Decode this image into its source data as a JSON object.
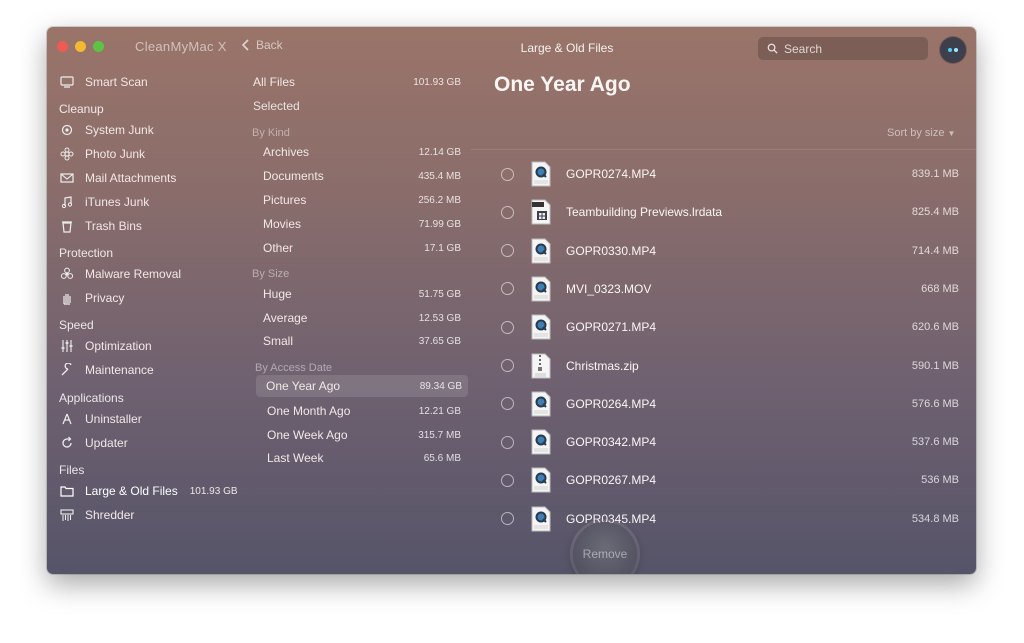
{
  "app": {
    "title": "CleanMyMac X",
    "back_label": "Back",
    "section_title": "Large & Old Files"
  },
  "search": {
    "placeholder": "Search"
  },
  "sidebar": {
    "smart_scan": "Smart Scan",
    "groups": [
      {
        "header": "Cleanup",
        "items": [
          "System Junk",
          "Photo Junk",
          "Mail Attachments",
          "iTunes Junk",
          "Trash Bins"
        ]
      },
      {
        "header": "Protection",
        "items": [
          "Malware Removal",
          "Privacy"
        ]
      },
      {
        "header": "Speed",
        "items": [
          "Optimization",
          "Maintenance"
        ]
      },
      {
        "header": "Applications",
        "items": [
          "Uninstaller",
          "Updater"
        ]
      },
      {
        "header": "Files",
        "items": [
          "Large & Old Files",
          "Shredder"
        ]
      }
    ],
    "large_files_badge": "101.93 GB"
  },
  "filters": {
    "all_files": {
      "label": "All Files",
      "size": "101.93 GB"
    },
    "selected": "Selected",
    "by_kind": {
      "header": "By Kind",
      "items": [
        {
          "label": "Archives",
          "size": "12.14 GB"
        },
        {
          "label": "Documents",
          "size": "435.4 MB"
        },
        {
          "label": "Pictures",
          "size": "256.2 MB"
        },
        {
          "label": "Movies",
          "size": "71.99 GB"
        },
        {
          "label": "Other",
          "size": "17.1 GB"
        }
      ]
    },
    "by_size": {
      "header": "By Size",
      "items": [
        {
          "label": "Huge",
          "size": "51.75 GB"
        },
        {
          "label": "Average",
          "size": "12.53 GB"
        },
        {
          "label": "Small",
          "size": "37.65 GB"
        }
      ]
    },
    "by_access": {
      "header": "By Access Date",
      "items": [
        {
          "label": "One Year Ago",
          "size": "89.34 GB"
        },
        {
          "label": "One Month Ago",
          "size": "12.21 GB"
        },
        {
          "label": "One Week Ago",
          "size": "315.7 MB"
        },
        {
          "label": "Last Week",
          "size": "65.6 MB"
        }
      ]
    }
  },
  "main": {
    "title": "One Year Ago",
    "sort_label": "Sort by size",
    "files": [
      {
        "name": "GOPR0274.MP4",
        "size": "839.1 MB",
        "icon": "video-file-icon"
      },
      {
        "name": "Teambuilding Previews.lrdata",
        "size": "825.4 MB",
        "icon": "data-file-icon"
      },
      {
        "name": "GOPR0330.MP4",
        "size": "714.4 MB",
        "icon": "video-file-icon"
      },
      {
        "name": "MVI_0323.MOV",
        "size": "668 MB",
        "icon": "mov-file-icon"
      },
      {
        "name": "GOPR0271.MP4",
        "size": "620.6 MB",
        "icon": "video-file-icon"
      },
      {
        "name": "Christmas.zip",
        "size": "590.1 MB",
        "icon": "zip-file-icon"
      },
      {
        "name": "GOPR0264.MP4",
        "size": "576.6 MB",
        "icon": "video-file-icon"
      },
      {
        "name": "GOPR0342.MP4",
        "size": "537.6 MB",
        "icon": "video-file-icon"
      },
      {
        "name": "GOPR0267.MP4",
        "size": "536 MB",
        "icon": "video-file-icon"
      },
      {
        "name": "GOPR0345.MP4",
        "size": "534.8 MB",
        "icon": "video-file-icon"
      }
    ],
    "remove_label": "Remove"
  }
}
